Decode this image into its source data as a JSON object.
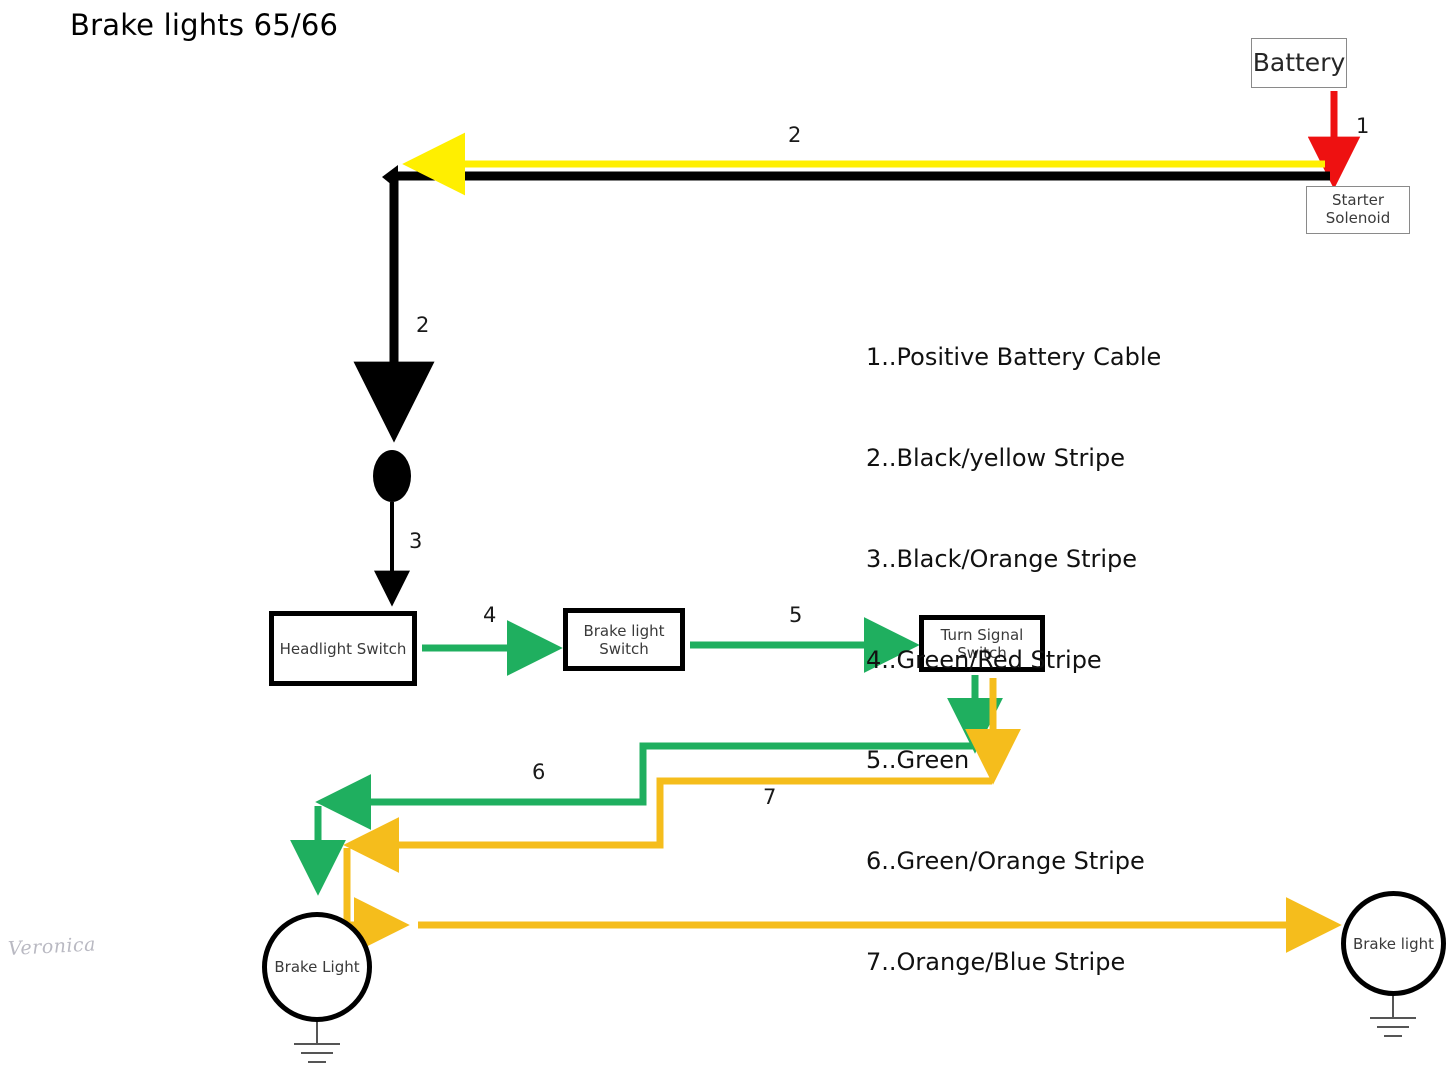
{
  "title": "Brake lights 65/66",
  "signature": "Veronica",
  "colors": {
    "black": "#000000",
    "yellow": "#ffef00",
    "red": "#ee1111",
    "green": "#1faf5f",
    "amber": "#f5bd1c",
    "box_border_thin": "#8a8a8a",
    "text": "#3a3a3a"
  },
  "nodes": {
    "battery": "Battery",
    "starter_solenoid": "Starter\nSolenoid",
    "headlight_switch": "Headlight\nSwitch",
    "brake_light_switch": "Brake light\nSwitch",
    "turn_signal_switch": "Turn Signal\nSwitch",
    "brake_light_left": "Brake\nLight",
    "brake_light_right": "Brake\nlight"
  },
  "wire_labels": {
    "n1": "1",
    "n2_top": "2",
    "n2_vertical": "2",
    "n3": "3",
    "n4": "4",
    "n5": "5",
    "n6": "6",
    "n7": "7"
  },
  "legend": {
    "items": [
      "1..Positive Battery Cable",
      "2..Black/yellow Stripe",
      "3..Black/Orange Stripe",
      "4..Green/Red Stripe",
      "5..Green",
      "6..Green/Orange Stripe",
      "7..Orange/Blue Stripe"
    ]
  }
}
